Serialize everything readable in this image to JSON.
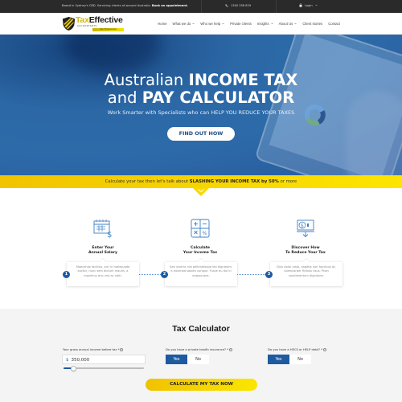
{
  "topbar": {
    "tagline_prefix": "Based in Sydney's CBD. Servicing clients all around Australia.",
    "tagline_link": "Book an appointment.",
    "phone": "1300 358 829",
    "login_label": "Login"
  },
  "logo": {
    "brand_tax": "Tax",
    "brand_effective": "Effective",
    "sub": "ACCOUNTANTS",
    "tag": "Your Financial Ark"
  },
  "nav": {
    "items": [
      {
        "label": "Home",
        "dropdown": false
      },
      {
        "label": "What we do",
        "dropdown": true
      },
      {
        "label": "Who we help",
        "dropdown": true
      },
      {
        "label": "Private clients",
        "dropdown": false
      },
      {
        "label": "Insights",
        "dropdown": true
      },
      {
        "label": "About Us",
        "dropdown": true
      },
      {
        "label": "Client stories",
        "dropdown": false
      },
      {
        "label": "Contact",
        "dropdown": false
      }
    ]
  },
  "hero": {
    "line1_light": "Australian ",
    "line1_bold": "INCOME TAX",
    "line2_light": "and ",
    "line2_bold": "PAY CALCULATOR",
    "subtitle": "Work Smarter with Specialists who can HELP YOU REDUCE YOUR TAXES",
    "cta": "FIND OUT HOW"
  },
  "banner": {
    "prefix": "Calculate your tax then let's talk about ",
    "bold": "SLASHING YOUR INCOME TAX by 50%",
    "suffix": " or more"
  },
  "steps": [
    {
      "number": "1",
      "title_l1": "Enter Your",
      "title_l2": "Annual Salary",
      "text": "Maecenas facilisis, orci in malesuada auctor, nunc sem dictum mauris, a maximus arcu est ac nibh.",
      "icon": "calendar-dollar-icon"
    },
    {
      "number": "2",
      "title_l1": "Calculate",
      "title_l2": "Your Income Tax",
      "text": "Sed viverra nisi pellentesque leo dignissim, a euismod sapien congue. Fusce eu dui in erapsouere.",
      "icon": "calculator-icon"
    },
    {
      "number": "3",
      "title_l1": "Discover How",
      "title_l2": "To Reduce Your Tax",
      "text": "Duis dolor justo, sagittis non faucibus at, ullamcorper finibus risus. Proin condimentum dignissim.",
      "icon": "money-down-icon"
    }
  ],
  "calculator": {
    "title": "Tax Calculator",
    "income_label": "Your gross annual income before tax *",
    "currency": "$",
    "income_value": "350,000",
    "slider_fraction": 0.12,
    "health_label": "Do you have a private health insurance? *",
    "health_yes": "Yes",
    "health_no": "No",
    "health_selected": "Yes",
    "hecs_label": "Do you have a HECS or HELP debt? *",
    "hecs_yes": "Yes",
    "hecs_no": "No",
    "hecs_selected": "Yes",
    "submit": "CALCULATE MY TAX NOW"
  },
  "colors": {
    "brand_blue": "#1e5aa0",
    "brand_yellow": "#f5d400",
    "topbar": "#2a2a2a"
  }
}
